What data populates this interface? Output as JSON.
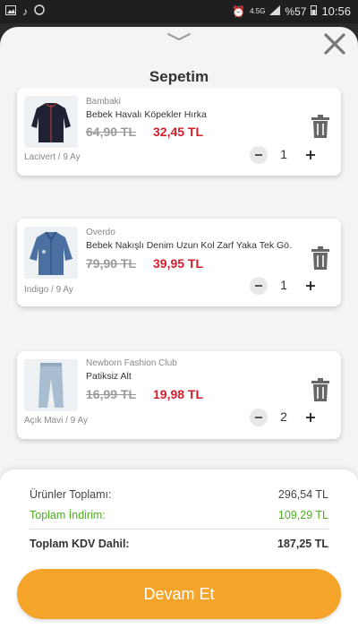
{
  "status_bar": {
    "battery": "%57",
    "time": "10:56",
    "network": "4.5G"
  },
  "sheet": {
    "title": "Sepetim"
  },
  "items": [
    {
      "brand": "Bambaki",
      "name": "Bebek Havalı Köpekler Hırka",
      "old_price": "64,90 TL",
      "new_price": "32,45 TL",
      "variant": "Lacivert / 9 Ay",
      "quantity": "1"
    },
    {
      "brand": "Overdo",
      "name": "Bebek Nakışlı Denim Uzun Kol Zarf Yaka Tek Gö…",
      "old_price": "79,90 TL",
      "new_price": "39,95 TL",
      "variant": "Indigo / 9 Ay",
      "quantity": "1"
    },
    {
      "brand": "Newborn Fashion Club",
      "name": "Patiksiz Alt",
      "old_price": "16,99 TL",
      "new_price": "19,98 TL",
      "variant": "Açık Mavi / 9 Ay",
      "quantity": "2"
    }
  ],
  "summary": {
    "subtotal_label": "Ürünler Toplamı:",
    "subtotal_value": "296,54 TL",
    "discount_label": "Toplam İndirim:",
    "discount_value": "109,29 TL",
    "total_label": "Toplam KDV Dahil:",
    "total_value": "187,25 TL"
  },
  "cta": {
    "label": "Devam Et"
  },
  "colors": {
    "accent": "#f5a42a",
    "sale_price": "#d0202e",
    "discount": "#4caf20"
  }
}
